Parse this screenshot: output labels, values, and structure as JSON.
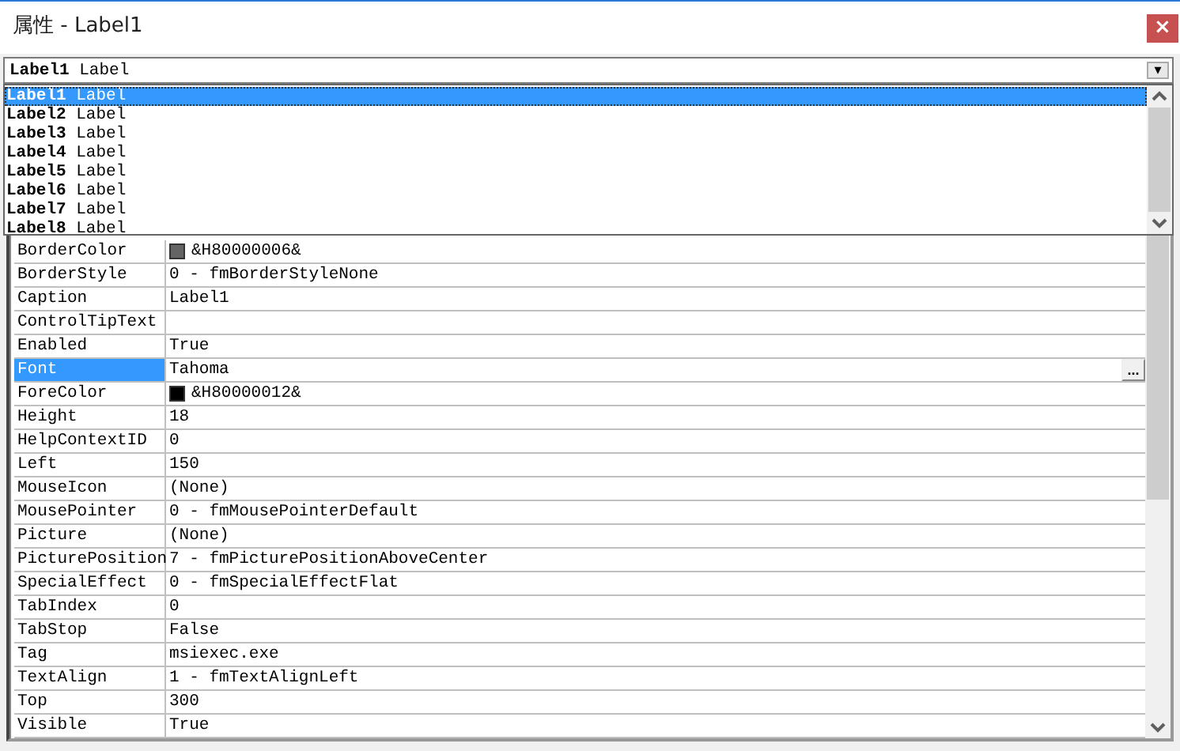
{
  "window": {
    "title": "属性 - Label1",
    "close": "×"
  },
  "object_box": {
    "name": "Label1",
    "type": "Label",
    "arrow": "▾"
  },
  "dropdown": {
    "items": [
      {
        "name": "Label1",
        "type": "Label",
        "selected": true
      },
      {
        "name": "Label2",
        "type": "Label",
        "selected": false
      },
      {
        "name": "Label3",
        "type": "Label",
        "selected": false
      },
      {
        "name": "Label4",
        "type": "Label",
        "selected": false
      },
      {
        "name": "Label5",
        "type": "Label",
        "selected": false
      },
      {
        "name": "Label6",
        "type": "Label",
        "selected": false
      },
      {
        "name": "Label7",
        "type": "Label",
        "selected": false
      },
      {
        "name": "Label8",
        "type": "Label",
        "selected": false
      }
    ]
  },
  "properties": [
    {
      "name": "BorderColor",
      "value": "&H80000006&",
      "kind": "color",
      "color": "#646464",
      "selected": false
    },
    {
      "name": "BorderStyle",
      "value": "0 - fmBorderStyleNone",
      "kind": "text",
      "selected": false
    },
    {
      "name": "Caption",
      "value": "Label1",
      "kind": "text",
      "selected": false
    },
    {
      "name": "ControlTipText",
      "kind": "text",
      "selected": false
    },
    {
      "name": "Enabled",
      "value": "True",
      "kind": "text",
      "selected": false
    },
    {
      "name": "Font",
      "value": "Tahoma",
      "kind": "font",
      "button": "...",
      "selected": true
    },
    {
      "name": "ForeColor",
      "value": "&H80000012&",
      "kind": "color",
      "color": "#000000",
      "selected": false
    },
    {
      "name": "Height",
      "value": "18",
      "kind": "text",
      "selected": false
    },
    {
      "name": "HelpContextID",
      "value": "0",
      "kind": "text",
      "selected": false
    },
    {
      "name": "Left",
      "value": "150",
      "kind": "text",
      "selected": false
    },
    {
      "name": "MouseIcon",
      "value": "(None)",
      "kind": "text",
      "selected": false
    },
    {
      "name": "MousePointer",
      "value": "0 - fmMousePointerDefault",
      "kind": "text",
      "selected": false
    },
    {
      "name": "Picture",
      "value": "(None)",
      "kind": "text",
      "selected": false
    },
    {
      "name": "PicturePosition",
      "value": "7 - fmPicturePositionAboveCenter",
      "kind": "text",
      "selected": false
    },
    {
      "name": "SpecialEffect",
      "value": "0 - fmSpecialEffectFlat",
      "kind": "text",
      "selected": false
    },
    {
      "name": "TabIndex",
      "value": "0",
      "kind": "text",
      "selected": false
    },
    {
      "name": "TabStop",
      "value": "False",
      "kind": "text",
      "selected": false
    },
    {
      "name": "Tag",
      "value": "msiexec.exe",
      "kind": "text",
      "selected": false
    },
    {
      "name": "TextAlign",
      "value": "1 - fmTextAlignLeft",
      "kind": "text",
      "selected": false
    },
    {
      "name": "Top",
      "value": "300",
      "kind": "text",
      "selected": false
    },
    {
      "name": "Visible",
      "value": "True",
      "kind": "text",
      "selected": false
    }
  ]
}
